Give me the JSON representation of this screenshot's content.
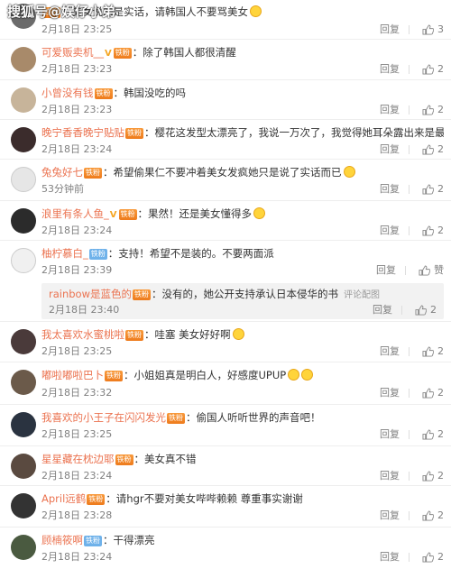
{
  "watermark": "搜狐号@娱仔小弟",
  "comments": [
    {
      "name": "",
      "text": "美女说的是实话，请韩国人不要骂美女",
      "time": "2月18日 23:25",
      "reply": "回复",
      "likes": "3"
    },
    {
      "name": "可爱贩卖机__",
      "text": "除了韩国人都很清醒",
      "time": "2月18日 23:23",
      "reply": "回复",
      "likes": "2"
    },
    {
      "name": "小曾没有钱",
      "text": "韩国没吃的吗",
      "time": "2月18日 23:23",
      "reply": "回复",
      "likes": "2"
    },
    {
      "name": "晚宁香香晚宁贴贴",
      "text": "樱花这发型太漂亮了，我说一万次了，我觉得她耳朵露出来是最好看的",
      "time": "2月18日 23:24",
      "reply": "回复",
      "likes": "2"
    },
    {
      "name": "兔兔好七",
      "text": "希望偷果仁不要冲着美女发疯她只是说了实话而已",
      "time": "53分钟前",
      "reply": "回复",
      "likes": "2"
    },
    {
      "name": "浪里有条人鱼_",
      "text": "果然！还是美女懂得多",
      "time": "2月18日 23:24",
      "reply": "回复",
      "likes": "2"
    },
    {
      "name": "柚柠慕白_",
      "text": "支持！希望不是装的。不要两面派",
      "time": "2月18日 23:39",
      "reply": "回复",
      "likes": "赞"
    },
    {
      "name": "我太喜欢水蜜桃啦",
      "text": "哇塞 美女好好啊",
      "time": "2月18日 23:25",
      "reply": "回复",
      "likes": "2"
    },
    {
      "name": "嘟啦嘟啦巴卜",
      "text": "小姐姐真是明白人，好感度UPUP",
      "time": "2月18日 23:32",
      "reply": "回复",
      "likes": "2"
    },
    {
      "name": "我喜欢的小王子在闪闪发光",
      "text": "偷国人听听世界的声音吧！",
      "time": "2月18日 23:25",
      "reply": "回复",
      "likes": "2"
    },
    {
      "name": "星星藏在枕边耶",
      "text": "美女真不错",
      "time": "2月18日 23:24",
      "reply": "回复",
      "likes": "2"
    },
    {
      "name": "April远鹤",
      "text": "请hgr不要对美女哔哔赖赖 尊重事实谢谢",
      "time": "2月18日 23:28",
      "reply": "回复",
      "likes": "2"
    },
    {
      "name": "顾楠筱啊",
      "text": "干得漂亮",
      "time": "2月18日 23:24",
      "reply": "回复",
      "likes": "2"
    }
  ],
  "nested_reply": {
    "name": "rainbow是蓝色的",
    "text": "没有的，她公开支持承认日本侵华的书",
    "report": "评论配图",
    "time": "2月18日 23:40",
    "reply": "回复",
    "likes": "2"
  },
  "badges": {
    "fans": "铁粉",
    "iron": "铁粉",
    "v": "V"
  },
  "colors": {
    "username": "#eb7350",
    "meta": "#808080",
    "fans_badge": "#f5882a",
    "iron_badge": "#6fb2ea"
  }
}
